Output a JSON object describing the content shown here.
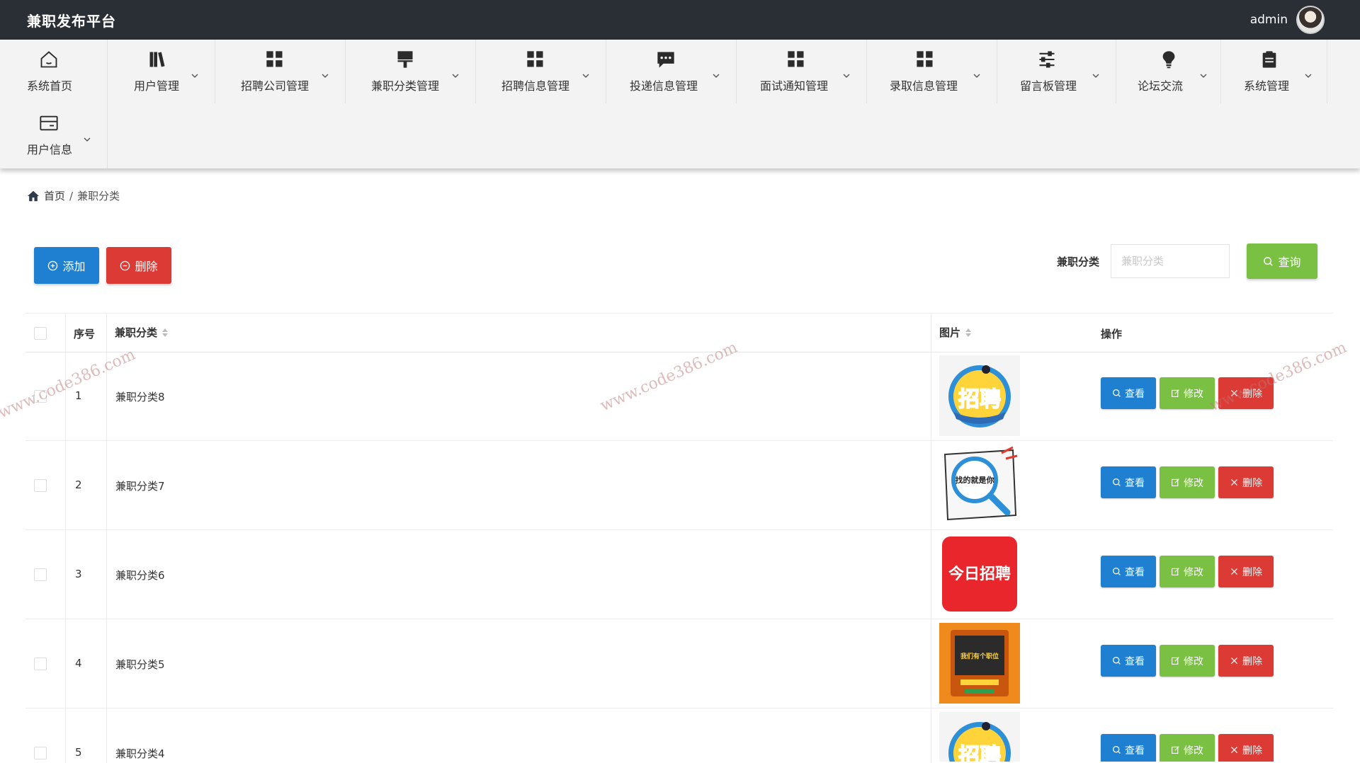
{
  "header": {
    "brand": "兼职发布平台",
    "username": "admin"
  },
  "nav": {
    "items": [
      {
        "label": "系统首页",
        "icon": "home-icon"
      },
      {
        "label": "用户管理",
        "icon": "books-icon"
      },
      {
        "label": "招聘公司管理",
        "icon": "grid-icon"
      },
      {
        "label": "兼职分类管理",
        "icon": "brush-icon"
      },
      {
        "label": "招聘信息管理",
        "icon": "grid-icon"
      },
      {
        "label": "投递信息管理",
        "icon": "chat-icon"
      },
      {
        "label": "面试通知管理",
        "icon": "grid-icon"
      },
      {
        "label": "录取信息管理",
        "icon": "grid-icon"
      },
      {
        "label": "留言板管理",
        "icon": "sliders-icon"
      },
      {
        "label": "论坛交流",
        "icon": "bulb-icon"
      },
      {
        "label": "系统管理",
        "icon": "clipboard-icon"
      },
      {
        "label": "用户信息",
        "icon": "card-icon"
      }
    ]
  },
  "breadcrumb": {
    "home": "首页",
    "separator": "/",
    "current": "兼职分类"
  },
  "toolbar": {
    "add_label": "添加",
    "delete_label": "删除"
  },
  "search": {
    "label": "兼职分类",
    "placeholder": "兼职分类",
    "value": "",
    "button_label": "查询"
  },
  "table": {
    "columns": {
      "index": "序号",
      "category": "兼职分类",
      "image": "图片",
      "actions": "操作"
    },
    "rows": [
      {
        "index": "1",
        "category": "兼职分类8",
        "image": "招聘"
      },
      {
        "index": "2",
        "category": "兼职分类7",
        "image": "找的就是你"
      },
      {
        "index": "3",
        "category": "兼职分类6",
        "image": "今日招聘"
      },
      {
        "index": "4",
        "category": "兼职分类5",
        "image": "我们有个职位"
      },
      {
        "index": "5",
        "category": "兼职分类4",
        "image": "招聘"
      }
    ],
    "actions": {
      "view": "查看",
      "edit": "修改",
      "delete": "删除"
    }
  },
  "watermark": {
    "text": "www.code386.com"
  },
  "colors": {
    "topbar": "#2a2f36",
    "nav": "#f3f3f3",
    "blue": "#1f7fd0",
    "green": "#7ac143",
    "red": "#dc3a35"
  }
}
